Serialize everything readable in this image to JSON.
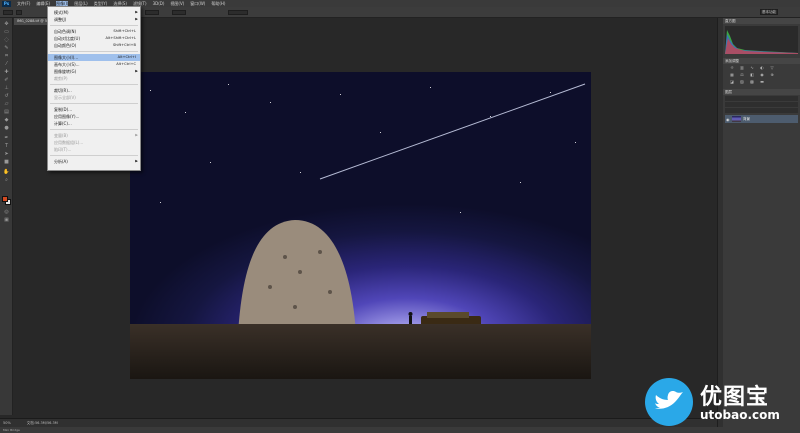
{
  "app": {
    "logo": "Ps"
  },
  "menubar": [
    "文件(F)",
    "编辑(E)",
    "图像(I)",
    "图层(L)",
    "类型(Y)",
    "选择(S)",
    "滤镜(T)",
    "3D(D)",
    "视图(V)",
    "窗口(W)",
    "帮助(H)"
  ],
  "document_tab": "IMG_0288.tif @ 50%(RGB/8)",
  "image_menu": {
    "items": [
      {
        "label": "模式(M)",
        "shortcut": "",
        "submenu": true,
        "disabled": false,
        "highlighted": false
      },
      {
        "label": "调整(J)",
        "shortcut": "",
        "submenu": true,
        "disabled": false,
        "highlighted": false
      },
      {
        "label": "自动色调(N)",
        "shortcut": "Shift+Ctrl+L",
        "submenu": false,
        "disabled": false,
        "highlighted": false
      },
      {
        "label": "自动对比度(U)",
        "shortcut": "Alt+Shift+Ctrl+L",
        "submenu": false,
        "disabled": false,
        "highlighted": false
      },
      {
        "label": "自动颜色(O)",
        "shortcut": "Shift+Ctrl+B",
        "submenu": false,
        "disabled": false,
        "highlighted": false
      },
      {
        "label": "图像大小(I)...",
        "shortcut": "Alt+Ctrl+I",
        "submenu": false,
        "disabled": false,
        "highlighted": true
      },
      {
        "label": "画布大小(S)...",
        "shortcut": "Alt+Ctrl+C",
        "submenu": false,
        "disabled": false,
        "highlighted": false
      },
      {
        "label": "图像旋转(G)",
        "shortcut": "",
        "submenu": true,
        "disabled": false,
        "highlighted": false
      },
      {
        "label": "裁剪(P)",
        "shortcut": "",
        "submenu": false,
        "disabled": true,
        "highlighted": false
      },
      {
        "label": "裁切(R)...",
        "shortcut": "",
        "submenu": false,
        "disabled": false,
        "highlighted": false
      },
      {
        "label": "显示全部(V)",
        "shortcut": "",
        "submenu": false,
        "disabled": true,
        "highlighted": false
      },
      {
        "label": "复制(D)...",
        "shortcut": "",
        "submenu": false,
        "disabled": false,
        "highlighted": false
      },
      {
        "label": "应用图像(Y)...",
        "shortcut": "",
        "submenu": false,
        "disabled": false,
        "highlighted": false
      },
      {
        "label": "计算(C)...",
        "shortcut": "",
        "submenu": false,
        "disabled": false,
        "highlighted": false
      },
      {
        "label": "变量(B)",
        "shortcut": "",
        "submenu": true,
        "disabled": true,
        "highlighted": false
      },
      {
        "label": "应用数据组(L)...",
        "shortcut": "",
        "submenu": false,
        "disabled": true,
        "highlighted": false
      },
      {
        "label": "陷印(T)...",
        "shortcut": "",
        "submenu": false,
        "disabled": true,
        "highlighted": false
      },
      {
        "label": "分析(A)",
        "shortcut": "",
        "submenu": true,
        "disabled": false,
        "highlighted": false
      }
    ]
  },
  "status": {
    "zoom": "50%",
    "doc_size": "文档:56.3M/56.3M"
  },
  "bottom_tab": "Mini Bridge",
  "panels": {
    "histogram_tab": "直方图",
    "adjustments_tab": "添加调整",
    "layers_tab": "图层",
    "layer_name": "背景",
    "workspace": "基本功能"
  },
  "watermark": {
    "name": "优图宝",
    "url": "utobao.com"
  },
  "colors": {
    "menu_highlight": "#9fc0ec",
    "foreground_swatch": "#d34a21",
    "watermark_blue": "#2aa8e8"
  }
}
